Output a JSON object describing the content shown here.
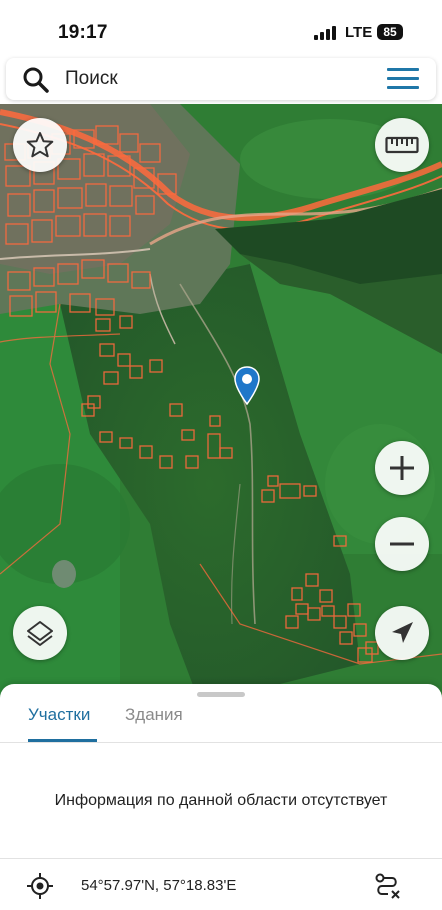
{
  "status_bar": {
    "time": "19:17",
    "network": "LTE",
    "battery": "85"
  },
  "search": {
    "placeholder": "Поиск",
    "icon": "search-icon",
    "menu_icon": "hamburger-menu-icon",
    "accent_color": "#1f77a8"
  },
  "map": {
    "layer": "satellite",
    "parcel_outline_color": "#ff6a3d",
    "controls": {
      "favorite": "star-icon",
      "ruler": "ruler-icon",
      "zoom_in": "plus-icon",
      "zoom_out": "minus-icon",
      "layers": "layers-icon",
      "my_location": "navigation-arrow-icon"
    },
    "marker": "location-pin-icon",
    "marker_color": "#1f77c9"
  },
  "sheet": {
    "tabs": [
      {
        "label": "Участки",
        "active": true
      },
      {
        "label": "Здания",
        "active": false
      }
    ],
    "info": "Информация по данной области отсутствует",
    "coordinates": "54°57.97'N, 57°18.83'E",
    "locate_icon": "crosshair-icon",
    "route_icon": "route-icon"
  }
}
